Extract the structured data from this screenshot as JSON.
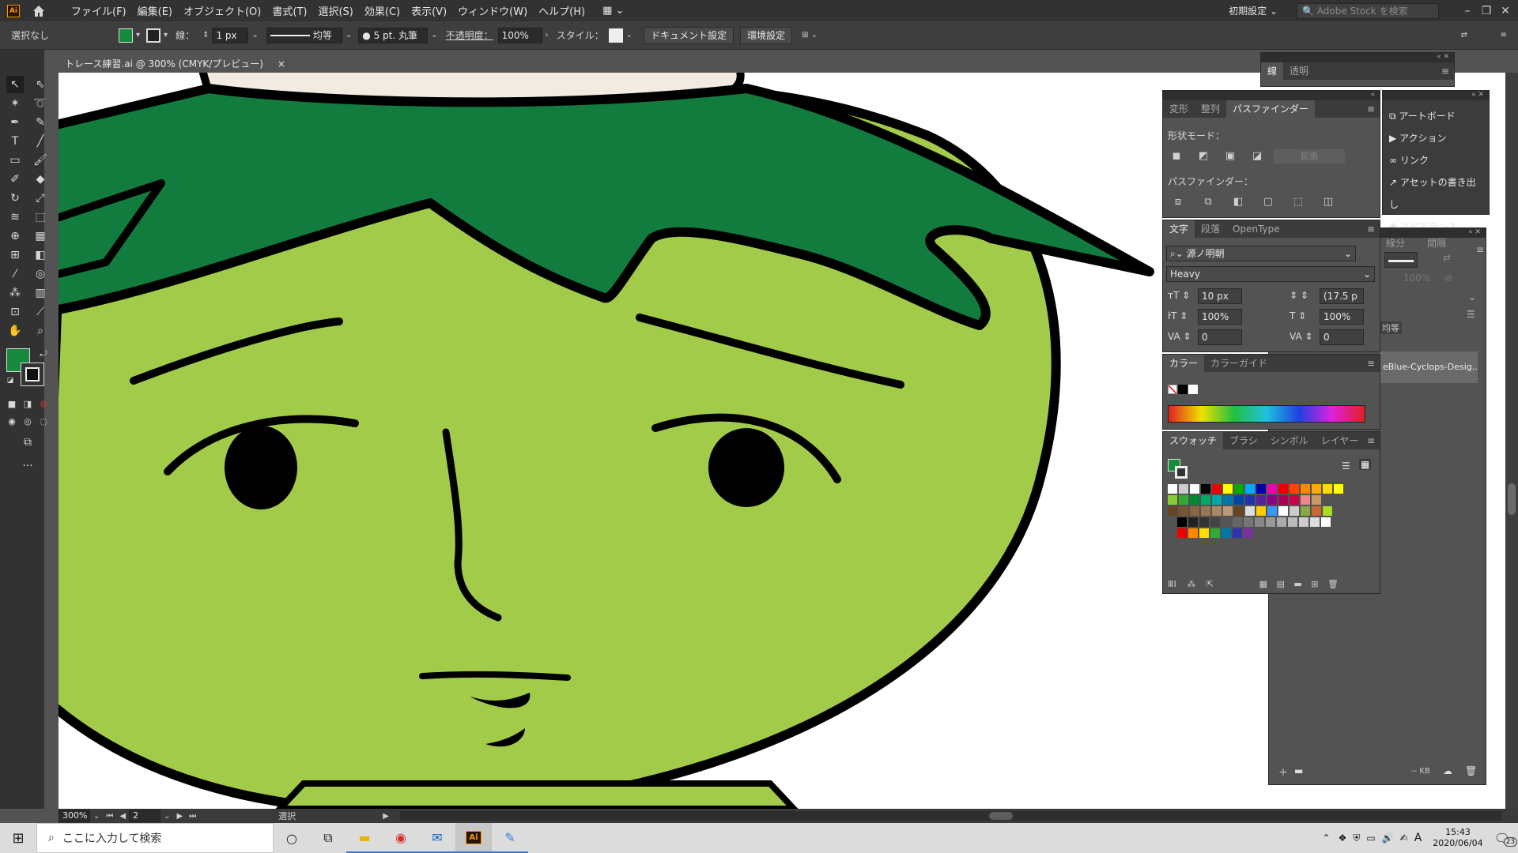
{
  "menubar": {
    "app_logo": "Ai",
    "items": [
      "ファイル(F)",
      "編集(E)",
      "オブジェクト(O)",
      "書式(T)",
      "選択(S)",
      "効果(C)",
      "表示(V)",
      "ウィンドウ(W)",
      "ヘルプ(H)"
    ],
    "workspace": "初期設定",
    "stock_search_placeholder": "Adobe Stock を検索"
  },
  "controlbar": {
    "selection": "選択なし",
    "stroke_label": "線：",
    "stroke_weight": "1 px",
    "stroke_profile": "均等",
    "brush": "5 pt. 丸筆",
    "opacity_label": "不透明度：",
    "opacity": "100%",
    "style_label": "スタイル：",
    "doc_setup_button": "ドキュメント設定",
    "preferences_button": "環境設定"
  },
  "document_tab": {
    "title": "トレース練習.ai @ 300% (CMYK/プレビュー)",
    "close": "×"
  },
  "statusbar": {
    "zoom": "300%",
    "artboard": "2",
    "tool": "選択"
  },
  "stroke_panel": {
    "tabs": [
      "線",
      "透明"
    ]
  },
  "pathfinder_panel": {
    "tabs": [
      "変形",
      "整列",
      "パスファインダー"
    ],
    "shape_modes_label": "形状モード：",
    "expand_button": "拡張",
    "pathfinder_label": "パスファインダー："
  },
  "character_panel": {
    "tabs": [
      "文字",
      "段落",
      "OpenType"
    ],
    "font_family": "源ノ明朝",
    "font_style": "Heavy",
    "font_size": "10 px",
    "leading": "(17.5 p",
    "vertical_scale": "100%",
    "horizontal_scale": "100%",
    "kerning": "0",
    "tracking": "0"
  },
  "color_panel": {
    "tabs": [
      "カラー",
      "カラーガイド"
    ]
  },
  "swatches_panel": {
    "tabs": [
      "スウォッチ",
      "ブラシ",
      "シンボル",
      "レイヤー"
    ]
  },
  "side_panel": {
    "items": [
      {
        "label": "アートボード",
        "icon": "artboard-icon"
      },
      {
        "label": "アクション",
        "icon": "play-icon"
      },
      {
        "label": "リンク",
        "icon": "link-icon"
      },
      {
        "label": "アセットの書き出し",
        "icon": "export-icon"
      },
      {
        "label": "アピアランス",
        "icon": "appearance-icon"
      }
    ]
  },
  "libraries_panel": {
    "partial_tabs": [
      "線分",
      "間隔"
    ],
    "uniform": "均等",
    "opacity": "100%",
    "library_name": "eBlue-Cyclops-Desig...",
    "size": "-- KB"
  },
  "taskbar": {
    "search_placeholder": "ここに入力して検索",
    "time": "15:43",
    "date": "2020/06/04",
    "ime": "A",
    "notifications": "23"
  },
  "colors": {
    "hair_green": "#127c3f",
    "face_green": "#a3cb4a",
    "outline": "#000000",
    "hat": "#f2ebe1",
    "fill_swatch": "#178a3e"
  }
}
